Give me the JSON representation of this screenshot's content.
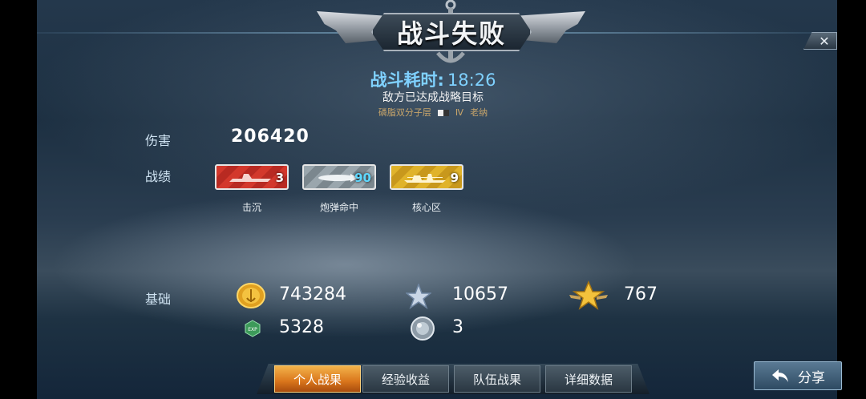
{
  "header": {
    "title": "战斗失败",
    "close_symbol": "✕"
  },
  "battle": {
    "time_label": "战斗耗时:",
    "time_value": "18:26",
    "reason": "敌方已达成战略目标",
    "ship_name": "磷脂双分子层",
    "tier": "Ⅳ",
    "player": "老纳"
  },
  "damage": {
    "label": "伤害",
    "value": "206420"
  },
  "record": {
    "label": "战绩",
    "badges": [
      {
        "caption": "击沉",
        "count": "3"
      },
      {
        "caption": "炮弹命中",
        "count": "90"
      },
      {
        "caption": "核心区",
        "count": "9"
      }
    ]
  },
  "basic": {
    "label": "基础",
    "coins": "743284",
    "silver_star": "10657",
    "gold_star": "767",
    "exp": "5328",
    "orb": "3"
  },
  "tabs": [
    {
      "label": "个人战果",
      "active": true
    },
    {
      "label": "经验收益",
      "active": false
    },
    {
      "label": "队伍战果",
      "active": false
    },
    {
      "label": "详细数据",
      "active": false
    }
  ],
  "share": {
    "label": "分享"
  }
}
